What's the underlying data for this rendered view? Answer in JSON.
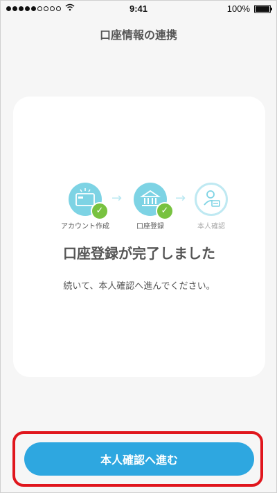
{
  "status_bar": {
    "time": "9:41",
    "battery": "100%",
    "signal_dots_filled": 5,
    "signal_dots_empty": 4
  },
  "header": {
    "title": "口座情報の連携"
  },
  "progress": {
    "steps": [
      {
        "label": "アカウント作成",
        "state": "done",
        "icon": "card-icon"
      },
      {
        "label": "口座登録",
        "state": "done",
        "icon": "bank-icon"
      },
      {
        "label": "本人確認",
        "state": "pending",
        "icon": "id-card-icon"
      }
    ]
  },
  "content": {
    "headline": "口座登録が完了しました",
    "subtext": "続いて、本人確認へ進んでください。"
  },
  "cta": {
    "label": "本人確認へ進む",
    "highlight_color": "#e0161d",
    "button_color": "#2ea7e0"
  },
  "colors": {
    "accent": "#7dd3e4",
    "check": "#78c240"
  }
}
